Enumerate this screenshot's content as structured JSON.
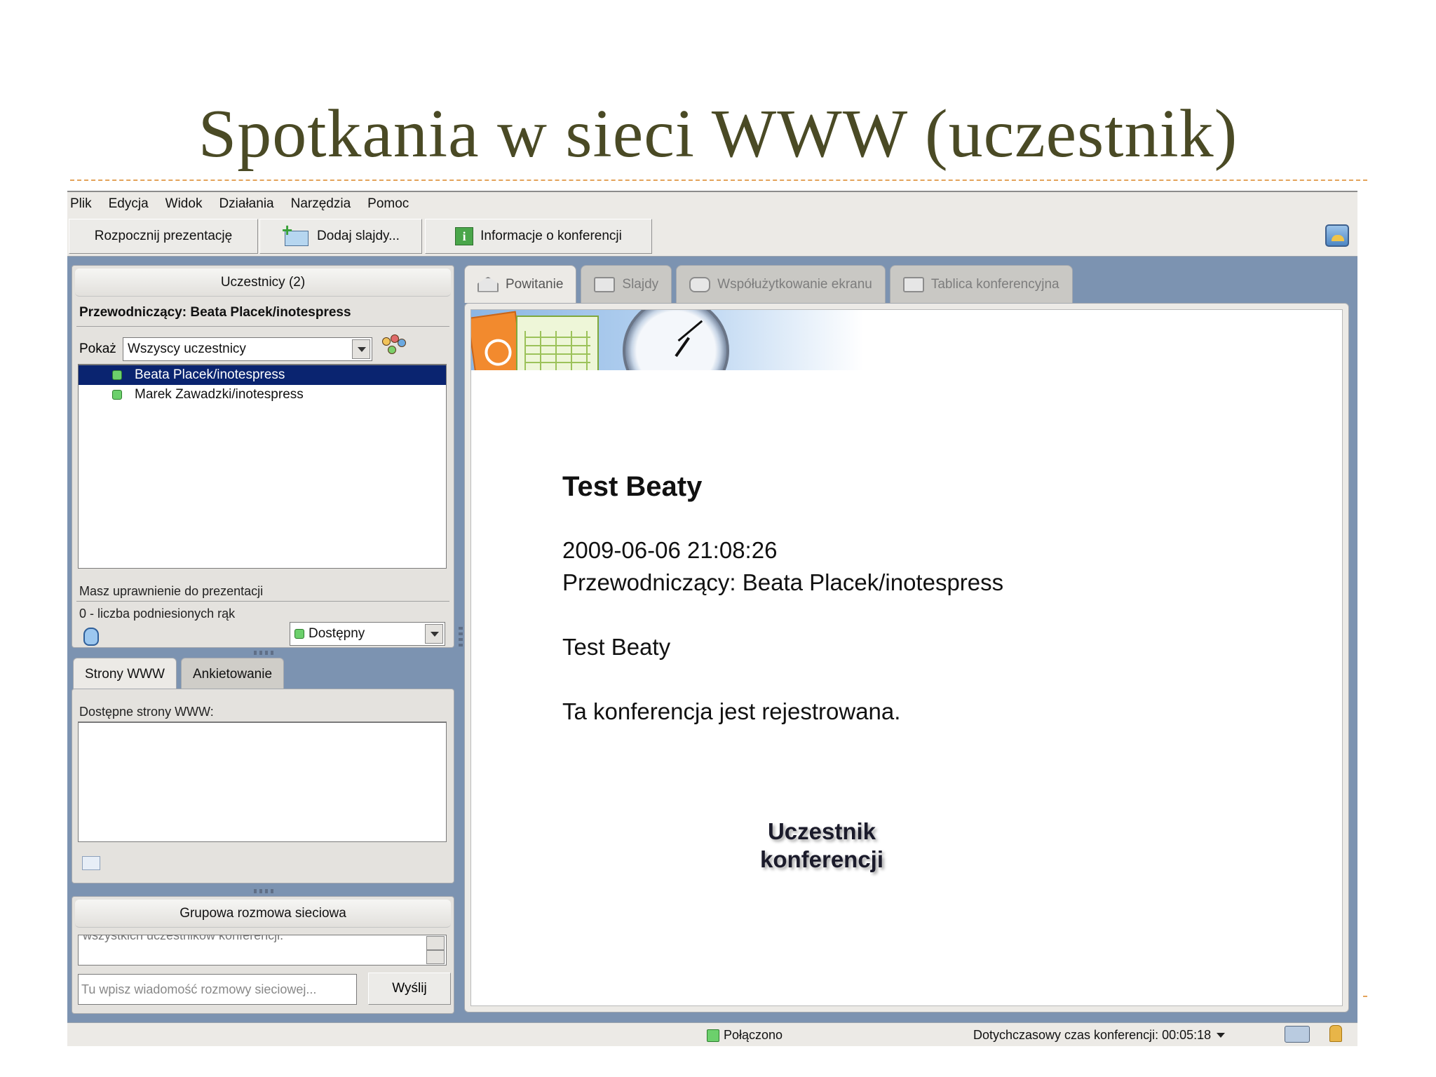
{
  "slide": {
    "title": "Spotkania w sieci WWW (uczestnik)"
  },
  "menu": [
    "Plik",
    "Edycja",
    "Widok",
    "Działania",
    "Narzędzia",
    "Pomoc"
  ],
  "toolbar": {
    "start_presentation": "Rozpocznij prezentację",
    "add_slides": "Dodaj slajdy...",
    "conference_info": "Informacje o konferencji",
    "icons": [
      "add-slides-icon",
      "info-icon",
      "screen-display-icon"
    ]
  },
  "participants_panel": {
    "title": "Uczestnicy (2)",
    "chairperson": "Przewodniczący: Beata Placek/inotespress",
    "show_label": "Pokaż",
    "show_select": "Wszyscy uczestnicy",
    "participants": [
      {
        "name": "Beata Placek/inotespress",
        "selected": true
      },
      {
        "name": "Marek Zawadzki/inotespress",
        "selected": false
      }
    ],
    "permission_text": "Masz uprawnienie do prezentacji",
    "raised_hands": "0 - liczba podniesionych rąk",
    "status_select": "Dostępny"
  },
  "web_panel": {
    "tabs": [
      "Strony WWW",
      "Ankietowanie"
    ],
    "available_label": "Dostępne strony WWW:"
  },
  "chat_panel": {
    "title": "Grupowa rozmowa sieciowa",
    "history_visible_text": "wszystkich uczestników konferencji.",
    "input_placeholder": "Tu wpisz wiadomość rozmowy sieciowej...",
    "send_label": "Wyślij"
  },
  "main_tabs": [
    "Powitanie",
    "Slajdy",
    "Współużytkowanie ekranu",
    "Tablica konferencyjna"
  ],
  "welcome": {
    "title": "Test Beaty",
    "datetime": "2009-06-06 21:08:26",
    "chair": "Przewodniczący: Beata Placek/inotespress",
    "description": "Test Beaty",
    "recording": "Ta konferencja jest rejestrowana."
  },
  "callout": {
    "line1": "Uczestnik",
    "line2": "konferencji"
  },
  "status": {
    "connection": "Połączono",
    "elapsed": "Dotychczasowy czas konferencji: 00:05:18"
  }
}
